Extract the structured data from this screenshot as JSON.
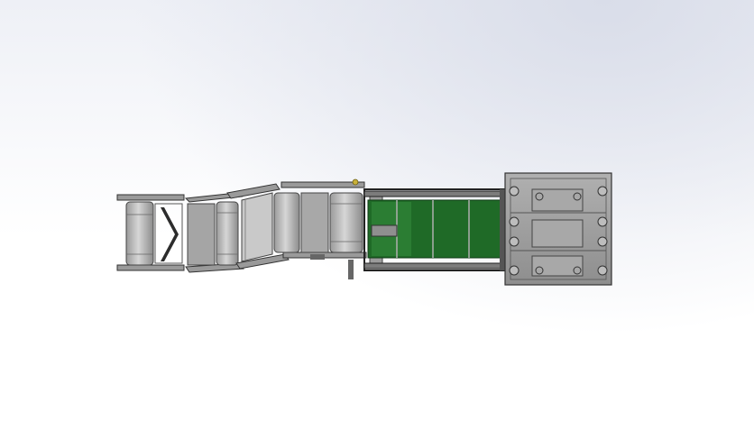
{
  "viewport": {
    "background_top": "#eef0f6",
    "background_bottom": "#ffffff"
  },
  "model": {
    "colors": {
      "frame": "#8a8a8a",
      "frame_dark": "#3c3c3c",
      "roller": "#b9b9b9",
      "panel_green": "#1f6a27",
      "panel_green_light": "#3f8f44",
      "base_plate": "#9e9e9e",
      "accent_yellow": "#c9b13a"
    },
    "parts": [
      "tail-conveyor-section",
      "middle-conveyor-section-1",
      "middle-conveyor-section-2",
      "green-panel-frame",
      "base-plate-assembly"
    ]
  }
}
